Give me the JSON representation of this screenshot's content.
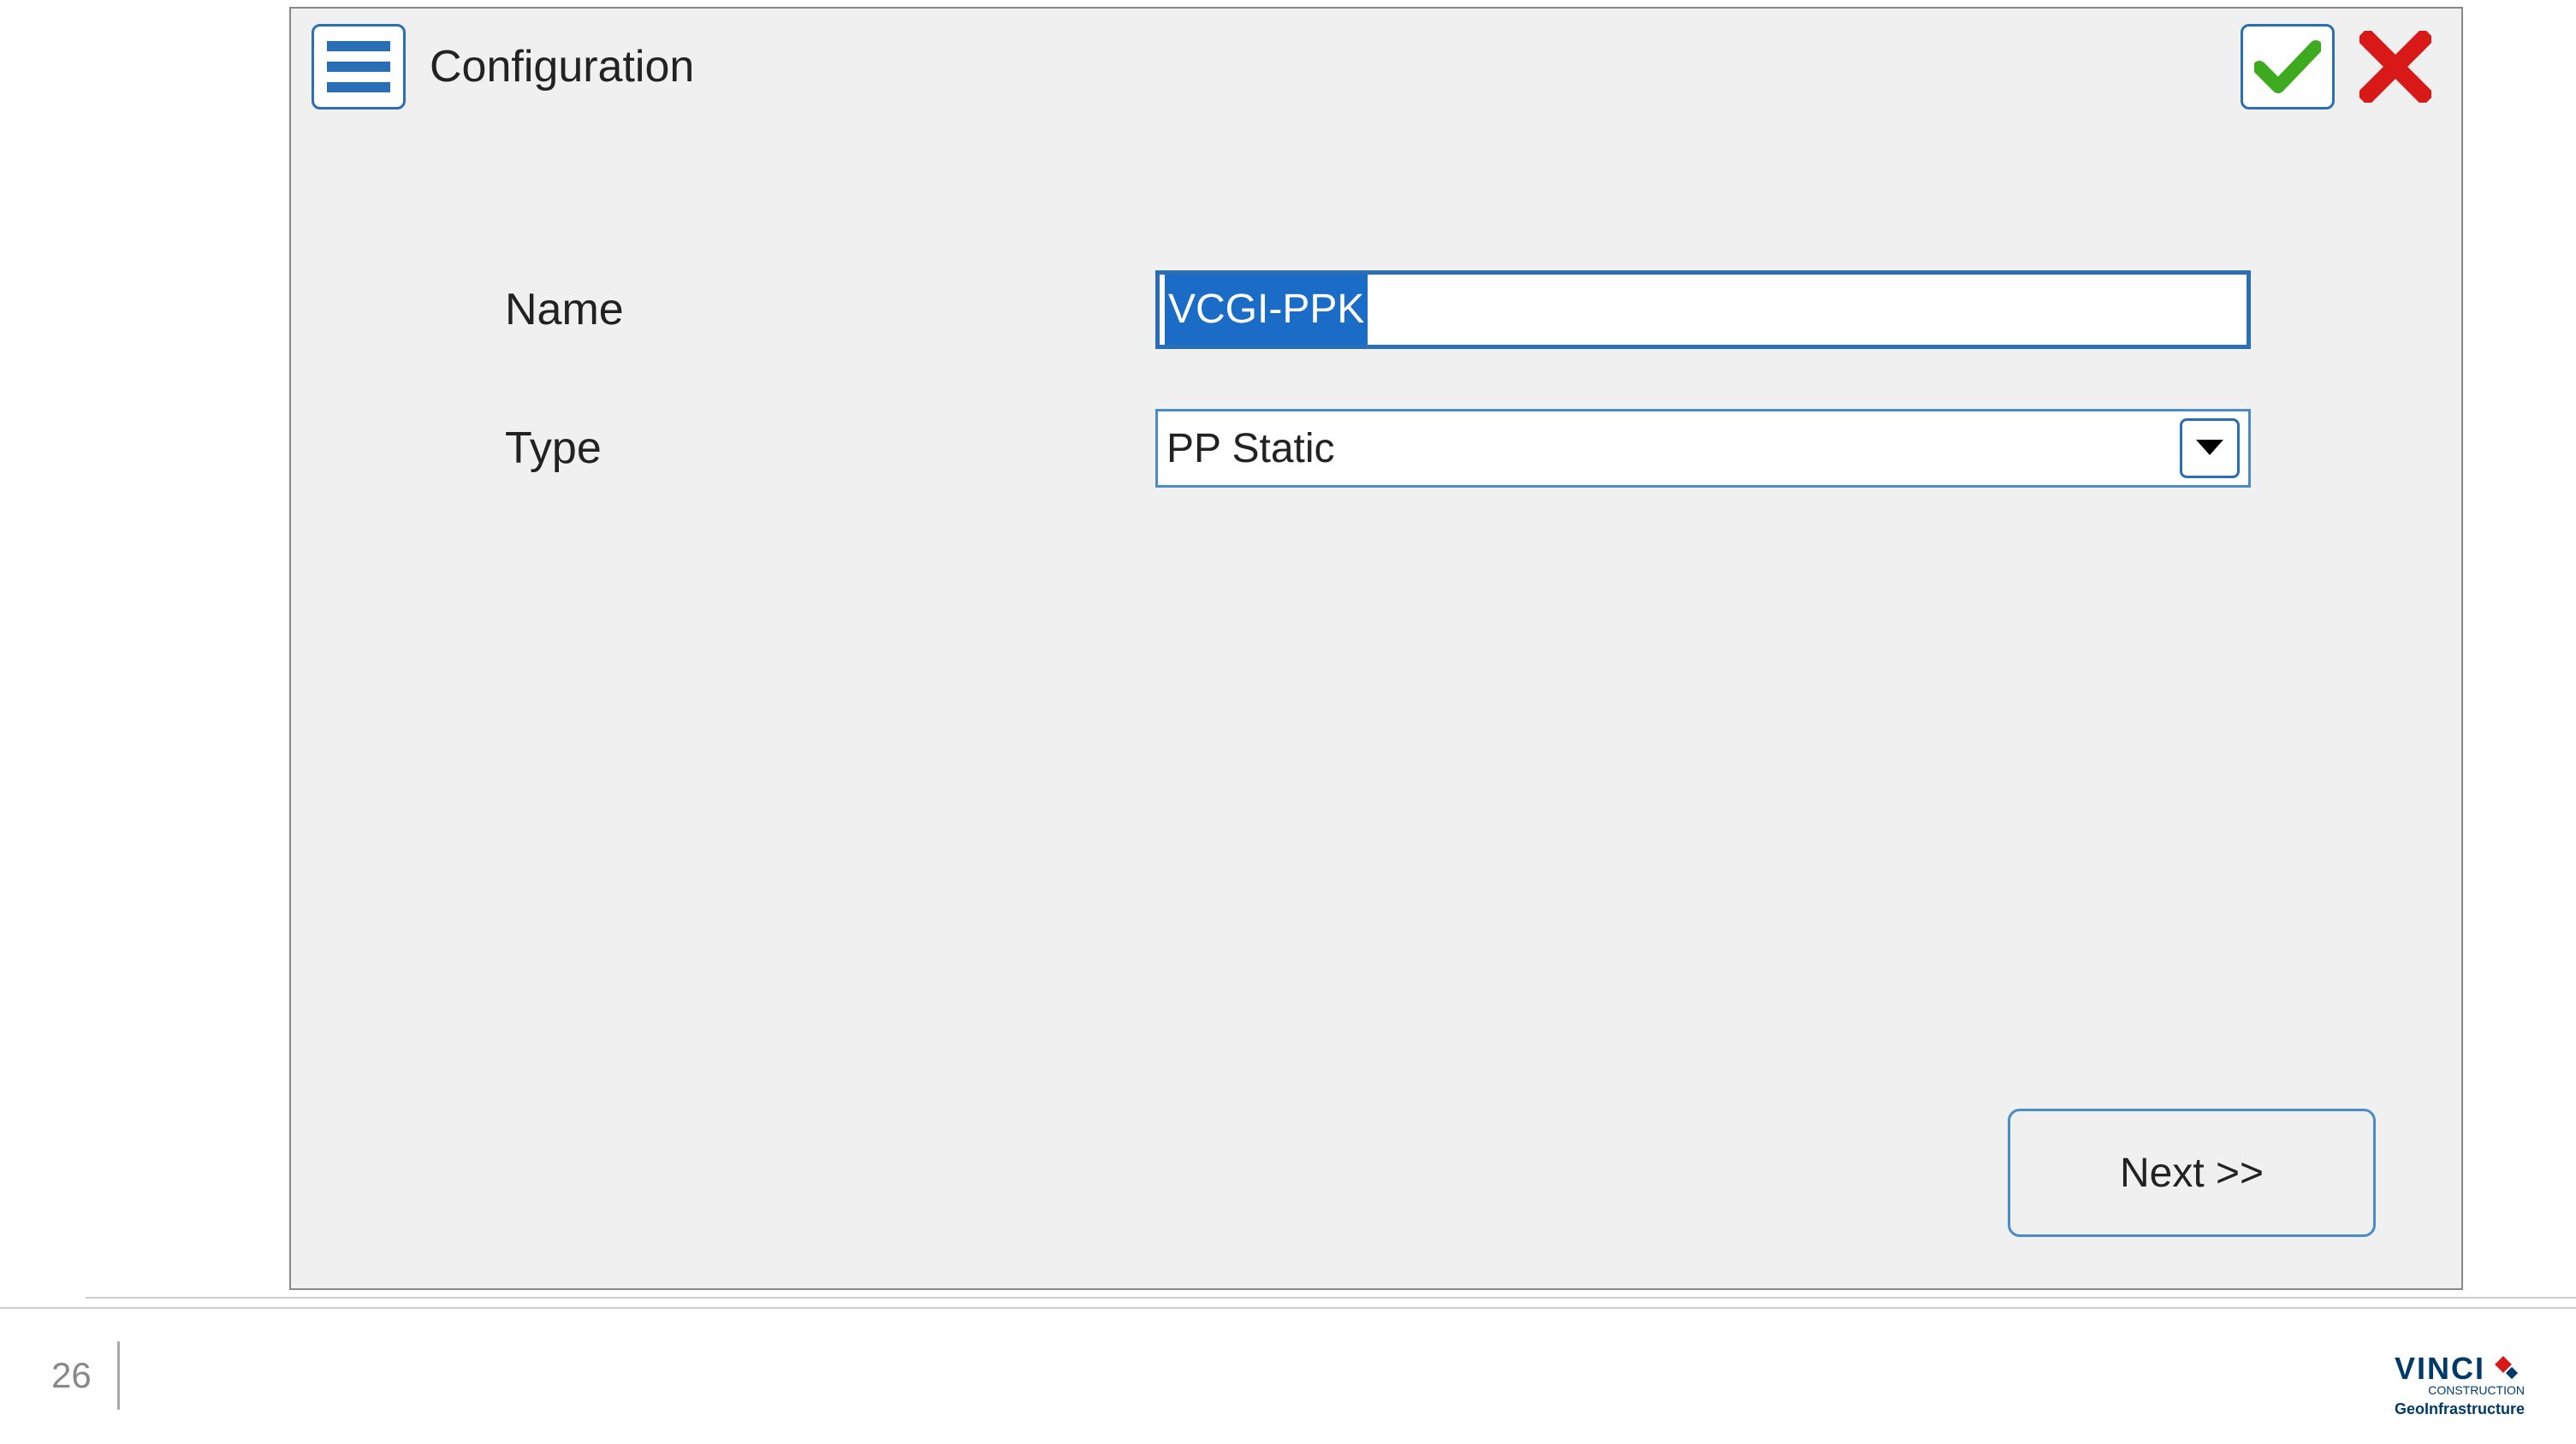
{
  "header": {
    "title": "Configuration"
  },
  "form": {
    "name_label": "Name",
    "name_value": "VCGI-PPK",
    "type_label": "Type",
    "type_value": "PP Static"
  },
  "actions": {
    "next_label": "Next >>"
  },
  "footer": {
    "page_number": "26",
    "logo_main": "VINCI",
    "logo_sub": "CONSTRUCTION",
    "logo_division": "GeoInfrastructure"
  }
}
